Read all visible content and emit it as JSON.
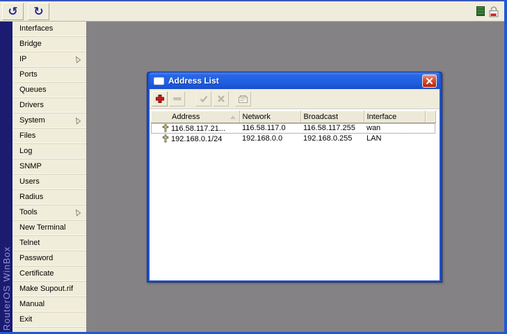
{
  "app": {
    "toolbar": {
      "undo_glyph": "↺",
      "redo_glyph": "↻"
    },
    "status": {
      "traffic_indicator": "green",
      "secure_lock": "locked"
    }
  },
  "brand": {
    "vertical_text": "RouterOS WinBox"
  },
  "sidebar": {
    "items": [
      {
        "label": "Interfaces",
        "has_submenu": false
      },
      {
        "label": "Bridge",
        "has_submenu": false
      },
      {
        "label": "IP",
        "has_submenu": true
      },
      {
        "label": "Ports",
        "has_submenu": false
      },
      {
        "label": "Queues",
        "has_submenu": false
      },
      {
        "label": "Drivers",
        "has_submenu": false
      },
      {
        "label": "System",
        "has_submenu": true
      },
      {
        "label": "Files",
        "has_submenu": false
      },
      {
        "label": "Log",
        "has_submenu": false
      },
      {
        "label": "SNMP",
        "has_submenu": false
      },
      {
        "label": "Users",
        "has_submenu": false
      },
      {
        "label": "Radius",
        "has_submenu": false
      },
      {
        "label": "Tools",
        "has_submenu": true
      },
      {
        "label": "New Terminal",
        "has_submenu": false
      },
      {
        "label": "Telnet",
        "has_submenu": false
      },
      {
        "label": "Password",
        "has_submenu": false
      },
      {
        "label": "Certificate",
        "has_submenu": false
      },
      {
        "label": "Make Supout.rif",
        "has_submenu": false
      },
      {
        "label": "Manual",
        "has_submenu": false
      },
      {
        "label": "Exit",
        "has_submenu": false
      }
    ]
  },
  "window": {
    "title": "Address List",
    "close_label": "close",
    "toolbar_buttons": [
      "add",
      "remove",
      "enable",
      "disable",
      "comment"
    ],
    "table": {
      "columns": [
        "Address",
        "Network",
        "Broadcast",
        "Interface"
      ],
      "sorted_by": "Address",
      "rows": [
        {
          "address": "116.58.117.21...",
          "network": "116.58.117.0",
          "broadcast": "116.58.117.255",
          "interface": "wan"
        },
        {
          "address": "192.168.0.1/24",
          "network": "192.168.0.0",
          "broadcast": "192.168.0.255",
          "interface": "LAN"
        }
      ]
    }
  },
  "colors": {
    "desktop_gray": "#848284",
    "panel_beige": "#efecdb",
    "band_navy": "#1b1b72",
    "band_text": "#9292d6",
    "window_border_blue": "#1e50cc",
    "titlebar_blue": "#2060e0",
    "close_red": "#cc3a1e",
    "add_plus_red": "#d01818",
    "address_icon_yellow": "#e6e27a",
    "traffic_green": "#3f8a3f"
  }
}
